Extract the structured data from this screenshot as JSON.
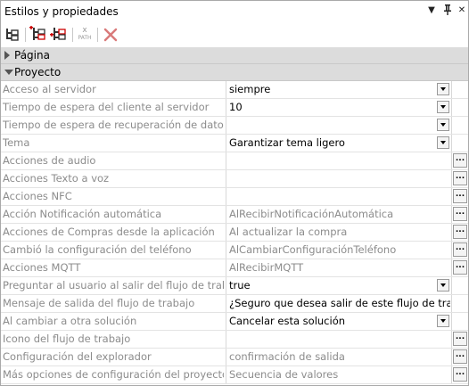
{
  "panel": {
    "title": "Estilos y propiedades"
  },
  "titlebar_controls": [
    {
      "name": "dropdown-arrow-icon",
      "glyph": "▼"
    },
    {
      "name": "pin-icon",
      "glyph": "ᛘ"
    },
    {
      "name": "close-icon",
      "glyph": "✕"
    }
  ],
  "toolbar": {
    "buttons": [
      {
        "name": "tree-view-icon"
      },
      {
        "name": "add-property-icon"
      },
      {
        "name": "add-child-icon"
      },
      {
        "name": "xpath-icon",
        "label": "PATH"
      },
      {
        "name": "delete-icon"
      }
    ]
  },
  "groups": [
    {
      "label": "Página",
      "expanded": false
    },
    {
      "label": "Proyecto",
      "expanded": true
    }
  ],
  "rows": [
    {
      "name": "Acceso al servidor",
      "value": "siempre",
      "style": "dark",
      "control": "dropdown"
    },
    {
      "name": "Tiempo de espera del cliente al servidor",
      "value": "10",
      "style": "dark",
      "control": "dropdown"
    },
    {
      "name": "Tiempo de espera de recuperación de datos del",
      "value": "",
      "style": "dark",
      "control": "dropdown"
    },
    {
      "name": "Tema",
      "value": "Garantizar tema ligero",
      "style": "dark",
      "control": "dropdown"
    },
    {
      "name": "Acciones de audio",
      "value": "",
      "style": "gray",
      "control": "dots"
    },
    {
      "name": "Acciones Texto a voz",
      "value": "",
      "style": "gray",
      "control": "dots"
    },
    {
      "name": "Acciones NFC",
      "value": "",
      "style": "gray",
      "control": "dots"
    },
    {
      "name": "Acción Notificación automática",
      "value": "AlRecibirNotificaciónAutomática",
      "style": "gray",
      "control": "dots"
    },
    {
      "name": "Acciones de Compras desde la aplicación",
      "value": "Al actualizar la compra",
      "style": "gray",
      "control": "dots"
    },
    {
      "name": "Cambió la configuración del teléfono",
      "value": "AlCambiarConfiguraciónTeléfono",
      "style": "gray",
      "control": "dots"
    },
    {
      "name": "Acciones MQTT",
      "value": "AlRecibirMQTT",
      "style": "gray",
      "control": "dots"
    },
    {
      "name": "Preguntar al usuario al salir del flujo de trabajo",
      "value": "true",
      "style": "dark",
      "control": "dropdown"
    },
    {
      "name": "Mensaje de salida del flujo de trabajo",
      "value": "¿Seguro que desea salir de este flujo de trabajo?",
      "style": "dark",
      "control": "none"
    },
    {
      "name": "Al cambiar a otra solución",
      "value": "Cancelar esta solución",
      "style": "dark",
      "control": "dropdown"
    },
    {
      "name": "Icono del flujo de trabajo",
      "value": "",
      "style": "gray",
      "control": "dots"
    },
    {
      "name": "Configuración del explorador",
      "value": "confirmación de salida",
      "style": "gray",
      "control": "dots"
    },
    {
      "name": "Más opciones de configuración del proyecto",
      "value": "Secuencia de valores",
      "style": "gray",
      "control": "dots"
    }
  ],
  "dots_label": "..."
}
